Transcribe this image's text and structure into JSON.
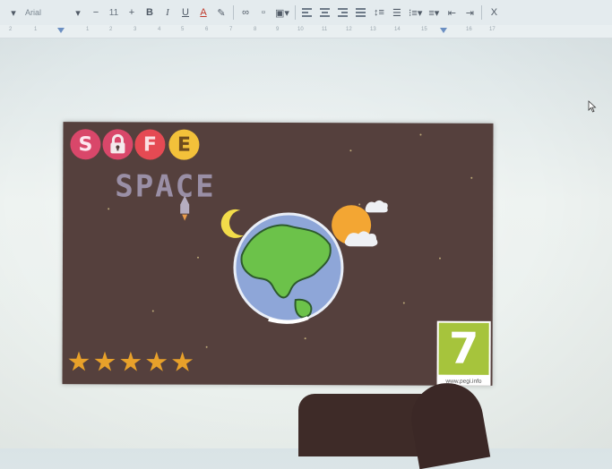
{
  "toolbar": {
    "font_name": "Arial",
    "font_size": "11",
    "minus_label": "−",
    "plus_label": "+",
    "bold_label": "B",
    "italic_label": "I",
    "underline_label": "U",
    "text_color_label": "A",
    "clear_format_label": "X"
  },
  "ruler": {
    "ticks": [
      "2",
      "1",
      "1",
      "2",
      "3",
      "4",
      "5",
      "6",
      "7",
      "8",
      "9",
      "10",
      "11",
      "12",
      "13",
      "14",
      "15",
      "16",
      "17",
      "18"
    ]
  },
  "slide": {
    "logo_letters": [
      "S",
      "F",
      "E"
    ],
    "space_word": "SPACE",
    "rating_stars": 5,
    "star_glyph": "★",
    "peg_number": "7",
    "peg_url": "www.pegi.info"
  },
  "colors": {
    "slide_bg": "#55403d",
    "logo_s": "#d9476a",
    "logo_lock": "#d9476a",
    "logo_f": "#e54a53",
    "logo_e": "#f3c13a",
    "peg_green": "#a6c43c",
    "star": "#e8a12a"
  },
  "icons": [
    "padlock-icon",
    "moon-icon",
    "earth-icon",
    "sun-cloud-icon",
    "cursor-icon",
    "rocket-icon"
  ]
}
